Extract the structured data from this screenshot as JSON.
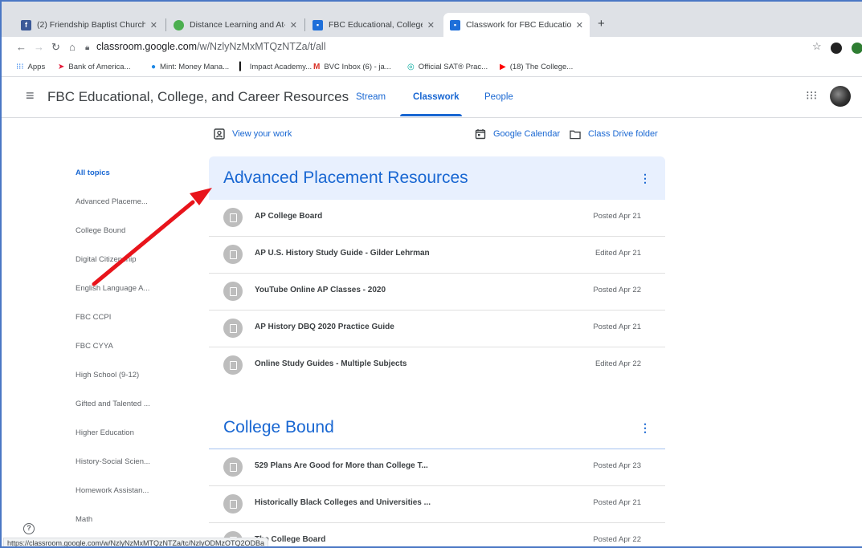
{
  "browser": {
    "tabs": [
      {
        "title": "(2) Friendship Baptist Church",
        "color": "#3b5998",
        "icon": "facebook-icon"
      },
      {
        "title": "Distance Learning and At-Hom",
        "color": "#4caf50",
        "icon": "cube-icon"
      },
      {
        "title": "FBC Educational, College, and",
        "color": "#1e6fd9",
        "icon": "classroom-icon"
      },
      {
        "title": "Classwork for FBC Educational",
        "color": "#1e6fd9",
        "icon": "classroom-icon"
      }
    ],
    "new_tab": "+",
    "url_host": "classroom.google.com",
    "url_path": "/w/NzlyNzMxMTQzNTZa/t/all",
    "bookmarks": [
      "Apps",
      "Bank of America...",
      "Mint: Money Mana...",
      "Impact Academy...",
      "BVC Inbox (6) - ja...",
      "Official SAT® Prac...",
      "(18) The College..."
    ]
  },
  "header": {
    "class_name": "FBC Educational, College, and Career Resources",
    "tabs": [
      "Stream",
      "Classwork",
      "People"
    ]
  },
  "actions": {
    "view_work": "View your work",
    "calendar": "Google Calendar",
    "drive": "Class Drive folder"
  },
  "sidebar": {
    "items": [
      "All topics",
      "Advanced Placeme...",
      "College Bound",
      "Digital Citizenship",
      "English Language A...",
      "FBC CCPI",
      "FBC CYYA",
      "High School (9-12)",
      "Gifted and Talented ...",
      "Higher Education",
      "History-Social Scien...",
      "Homework Assistan...",
      "Math"
    ]
  },
  "topics": [
    {
      "title": "Advanced Placement Resources",
      "items": [
        {
          "title": "AP College Board",
          "date": "Posted Apr 21"
        },
        {
          "title": "AP U.S. History Study Guide - Gilder Lehrman",
          "date": "Edited Apr 21"
        },
        {
          "title": "YouTube Online AP Classes - 2020",
          "date": "Posted Apr 22"
        },
        {
          "title": "AP History DBQ 2020 Practice Guide",
          "date": "Posted Apr 21"
        },
        {
          "title": "Online Study Guides - Multiple Subjects",
          "date": "Edited Apr 22"
        }
      ]
    },
    {
      "title": "College Bound",
      "items": [
        {
          "title": "529 Plans Are Good for More than College T...",
          "date": "Posted Apr 23"
        },
        {
          "title": "Historically Black Colleges and Universities ...",
          "date": "Posted Apr 21"
        },
        {
          "title": "The College Board",
          "date": "Posted Apr 22"
        }
      ]
    }
  ],
  "status_url": "https://classroom.google.com/w/NzlyNzMxMTQzNTZa/tc/NzlyODMzOTQ2ODBa",
  "colors": {
    "accent": "#1967d2",
    "arrow": "#e8141b",
    "topic_bg": "#e8f0fe"
  }
}
